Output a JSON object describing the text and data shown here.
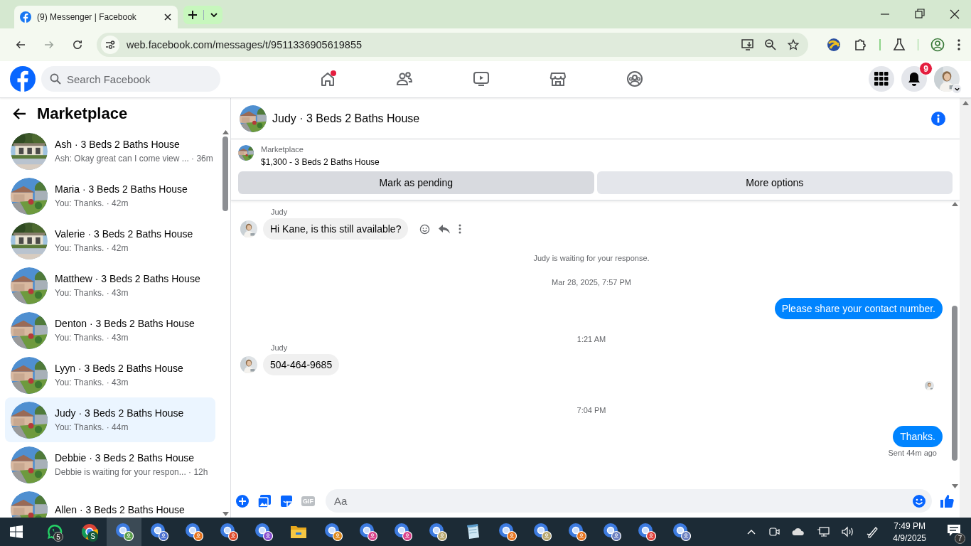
{
  "browser": {
    "tab": {
      "title": "(9) Messenger | Facebook"
    },
    "nav": [
      {
        "kind": "back",
        "disabled": false
      },
      {
        "kind": "forward",
        "disabled": true
      },
      {
        "kind": "reload",
        "disabled": false
      }
    ],
    "url": "web.facebook.com/messages/t/9511336905619855"
  },
  "facebook": {
    "search": {
      "placeholder": "Search Facebook"
    },
    "nav": [
      {
        "kind": "home",
        "dot": true
      },
      {
        "kind": "friends",
        "dot": false
      },
      {
        "kind": "video",
        "dot": false
      },
      {
        "kind": "marketplace",
        "dot": false
      },
      {
        "kind": "groups",
        "dot": false
      }
    ],
    "notifications": {
      "badge": "9"
    }
  },
  "sidebar": {
    "title": "Marketplace",
    "conversations": [
      {
        "name": "Ash · 3 Beds 2 Baths House",
        "preview": "Ash: Okay great can I come view ... · 36m",
        "selected": false
      },
      {
        "name": "Maria · 3 Beds 2 Baths House",
        "preview": "You: Thanks. · 42m",
        "selected": false
      },
      {
        "name": "Valerie · 3 Beds 2 Baths House",
        "preview": "You: Thanks. · 42m",
        "selected": false
      },
      {
        "name": "Matthew · 3 Beds 2 Baths House",
        "preview": "You: Thanks. · 43m",
        "selected": false
      },
      {
        "name": "Denton · 3 Beds 2 Baths House",
        "preview": "You: Thanks. · 43m",
        "selected": false
      },
      {
        "name": "Lyyn · 3 Beds 2 Baths House",
        "preview": "You: Thanks. · 43m",
        "selected": false
      },
      {
        "name": "Judy · 3 Beds 2 Baths House",
        "preview": "You: Thanks. · 44m",
        "selected": true
      },
      {
        "name": "Debbie · 3 Beds 2 Baths House",
        "preview": "Debbie is waiting for your respon... · 12h",
        "selected": false
      },
      {
        "name": "Allen · 3 Beds 2 Baths House",
        "selected": false
      }
    ]
  },
  "chat": {
    "title": "Judy · 3 Beds 2 Baths House",
    "listing": {
      "label": "Marketplace",
      "title": "$1,300 - 3 Beds 2 Baths House"
    },
    "buttons": [
      {
        "label": "Mark as pending",
        "kind": "primary"
      },
      {
        "label": "More options",
        "kind": "secondary"
      }
    ],
    "messages": [
      {
        "kind": "incoming",
        "sender": "Judy",
        "text": "Hi Kane, is this still available?",
        "show_actions": true
      },
      {
        "kind": "notice",
        "text": "Judy is waiting for your response."
      },
      {
        "kind": "time",
        "text": "Mar 28, 2025, 7:57 PM"
      },
      {
        "kind": "outgoing",
        "text": "Please share your contact number."
      },
      {
        "kind": "time",
        "text": "1:21 AM"
      },
      {
        "kind": "incoming",
        "sender": "Judy",
        "text": "504-464-9685",
        "show_actions": false
      },
      {
        "kind": "seen"
      },
      {
        "kind": "time",
        "text": "7:04 PM"
      },
      {
        "kind": "outgoing",
        "text": "Thanks."
      },
      {
        "kind": "receipt",
        "text": "Sent 44m ago"
      }
    ],
    "composer": {
      "gif": "GIF",
      "placeholder": "Aa"
    }
  },
  "taskbar": {
    "apps": [
      {
        "kind": "whatsapp",
        "badge": "5",
        "selected": false
      },
      {
        "kind": "chrome",
        "badge": "S",
        "selected": false
      },
      {
        "kind": "profile",
        "color": "#5a9e4b",
        "selected": true
      },
      {
        "kind": "profile",
        "color": "#4a6fd0",
        "selected": false
      },
      {
        "kind": "profile",
        "color": "#e8731c",
        "selected": false
      },
      {
        "kind": "profile",
        "color": "#e04a2a",
        "selected": false
      },
      {
        "kind": "profile",
        "color": "#8a4fd0",
        "selected": false
      },
      {
        "kind": "folder",
        "selected": false
      },
      {
        "kind": "profile",
        "color": "#e08a1c",
        "selected": false
      },
      {
        "kind": "profile",
        "color": "#d9418a",
        "selected": false
      },
      {
        "kind": "profile",
        "color": "#d9418a",
        "selected": false
      },
      {
        "kind": "profile",
        "color": "#b8a870",
        "selected": false
      },
      {
        "kind": "notepad",
        "selected": false
      },
      {
        "kind": "profile",
        "color": "#e8731c",
        "selected": false
      },
      {
        "kind": "profile",
        "color": "#b8a870",
        "selected": false
      },
      {
        "kind": "profile",
        "color": "#e8731c",
        "selected": false
      },
      {
        "kind": "profile",
        "color": "#6b7fc0",
        "selected": false
      },
      {
        "kind": "profile",
        "color": "#e0403a",
        "selected": false
      },
      {
        "kind": "profile",
        "color": "#6b7fc0",
        "selected": false
      }
    ],
    "clock": {
      "time": "7:49 PM",
      "date": "4/9/2025"
    },
    "notifications": "7"
  }
}
